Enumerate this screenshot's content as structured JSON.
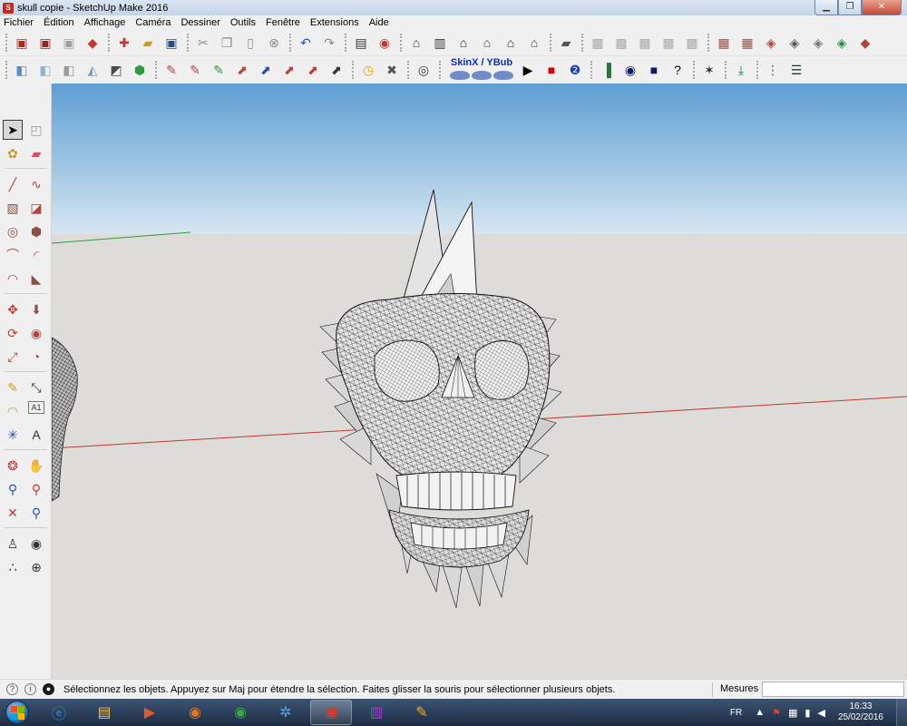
{
  "window": {
    "title": "skull copie - SketchUp Make 2016",
    "app_icon": "sketchup-logo-icon",
    "controls": [
      "minimize-icon",
      "maximize-icon",
      "close-icon"
    ]
  },
  "menu": [
    "Fichier",
    "Édition",
    "Affichage",
    "Caméra",
    "Dessiner",
    "Outils",
    "Fenêtre",
    "Extensions",
    "Aide"
  ],
  "toolbar1": [
    {
      "name": "open-model-icon",
      "glyph": "▣",
      "color": "#b8261b"
    },
    {
      "name": "model-info-icon",
      "glyph": "▣",
      "color": "#9d2420"
    },
    {
      "name": "component-icon",
      "glyph": "▣",
      "color": "#a0a0a0"
    },
    {
      "name": "ruby-icon",
      "glyph": "◆",
      "color": "#c0392b"
    },
    {
      "name": "new-file-icon",
      "glyph": "✚",
      "color": "#c0392b"
    },
    {
      "name": "open-folder-icon",
      "glyph": "▰",
      "color": "#c59a2f"
    },
    {
      "name": "save-icon",
      "glyph": "▣",
      "color": "#1f4e8c"
    },
    {
      "name": "cut-icon",
      "glyph": "✂",
      "color": "#8a8a8a"
    },
    {
      "name": "copy-icon",
      "glyph": "❐",
      "color": "#8a8a8a"
    },
    {
      "name": "paste-icon",
      "glyph": "▯",
      "color": "#8a8a8a"
    },
    {
      "name": "erase-selection-icon",
      "glyph": "⊗",
      "color": "#8a8a8a"
    },
    {
      "name": "undo-icon",
      "glyph": "↶",
      "color": "#1f55b8"
    },
    {
      "name": "redo-icon",
      "glyph": "↷",
      "color": "#8a8a8a"
    },
    {
      "name": "print-icon",
      "glyph": "▤",
      "color": "#333333"
    },
    {
      "name": "model-info-red-icon",
      "glyph": "◉",
      "color": "#c0392b"
    },
    {
      "name": "iso-view-icon",
      "glyph": "⌂",
      "color": "#333333"
    },
    {
      "name": "top-view-icon",
      "glyph": "▥",
      "color": "#333333"
    },
    {
      "name": "front-view-icon",
      "glyph": "⌂",
      "color": "#222222"
    },
    {
      "name": "right-view-icon",
      "glyph": "⌂",
      "color": "#444444"
    },
    {
      "name": "back-view-icon",
      "glyph": "⌂",
      "color": "#222222"
    },
    {
      "name": "left-view-icon",
      "glyph": "⌂",
      "color": "#444444"
    },
    {
      "name": "layers-icon",
      "glyph": "▰",
      "color": "#555555"
    },
    {
      "name": "style-xray-icon",
      "glyph": "▩",
      "color": "#aaaaaa"
    },
    {
      "name": "style-backedge-icon",
      "glyph": "▩",
      "color": "#aaaaaa"
    },
    {
      "name": "style-wireframe-icon",
      "glyph": "▩",
      "color": "#aaaaaa"
    },
    {
      "name": "style-hidden-icon",
      "glyph": "▩",
      "color": "#aaaaaa"
    },
    {
      "name": "style-shaded-icon",
      "glyph": "▩",
      "color": "#aaaaaa"
    },
    {
      "name": "sandbox-contours-icon",
      "glyph": "▦",
      "color": "#b0453a"
    },
    {
      "name": "sandbox-scratch-icon",
      "glyph": "▦",
      "color": "#b0453a"
    },
    {
      "name": "sandbox-smoove-icon",
      "glyph": "◈",
      "color": "#b0453a"
    },
    {
      "name": "sandbox-stamp-icon",
      "glyph": "◈",
      "color": "#555555"
    },
    {
      "name": "sandbox-drape-icon",
      "glyph": "◈",
      "color": "#777777"
    },
    {
      "name": "sandbox-detail-icon",
      "glyph": "◈",
      "color": "#2b8a3e"
    },
    {
      "name": "sandbox-flip-icon",
      "glyph": "◆",
      "color": "#b0453a"
    }
  ],
  "toolbar2": [
    {
      "name": "xray-cube-icon",
      "glyph": "◧",
      "color": "#5a8fc7"
    },
    {
      "name": "shaded-cube-icon",
      "glyph": "◧",
      "color": "#8fb0d8"
    },
    {
      "name": "monochrome-cube-icon",
      "glyph": "◧",
      "color": "#9a9a9a"
    },
    {
      "name": "textured-shape-icon",
      "glyph": "◭",
      "color": "#7aa0c8"
    },
    {
      "name": "section-plane-icon",
      "glyph": "◩",
      "color": "#4b4b4b"
    },
    {
      "name": "push-pull-green-icon",
      "glyph": "⬢",
      "color": "#2e9a3e"
    },
    {
      "name": "weld-icon",
      "glyph": "✎",
      "color": "#b0453a"
    },
    {
      "name": "curve-tool-icon",
      "glyph": "✎",
      "color": "#b0453a"
    },
    {
      "name": "bezier-icon",
      "glyph": "✎",
      "color": "#2e9a3e"
    },
    {
      "name": "extrude-icon",
      "glyph": "⬈",
      "color": "#b0453a"
    },
    {
      "name": "joint-push-icon",
      "glyph": "⬈",
      "color": "#2b4fb0"
    },
    {
      "name": "round-corner-icon",
      "glyph": "⬈",
      "color": "#b0453a"
    },
    {
      "name": "fredo-scale-icon",
      "glyph": "⬈",
      "color": "#b0453a"
    },
    {
      "name": "soften-icon",
      "glyph": "⬈",
      "color": "#333333"
    },
    {
      "name": "clock-icon",
      "glyph": "◷",
      "color": "#e0a800"
    },
    {
      "name": "tools-icon",
      "glyph": "✖",
      "color": "#555555"
    },
    {
      "name": "compass-icon",
      "glyph": "◎",
      "color": "#333333"
    }
  ],
  "skin_toolbar": {
    "label": "SkinX / YBub"
  },
  "toolbar2_tail": [
    {
      "name": "play-icon",
      "glyph": "▶",
      "color": "#000000"
    },
    {
      "name": "stop-icon",
      "glyph": "■",
      "color": "#d40000"
    },
    {
      "name": "number-two-icon",
      "glyph": "❷",
      "color": "#1d3fb3"
    },
    {
      "name": "green-bars-icon",
      "glyph": "▐",
      "color": "#1d7a3a"
    },
    {
      "name": "circle-icon",
      "glyph": "◉",
      "color": "#0b1a6e"
    },
    {
      "name": "blue-square-icon",
      "glyph": "■",
      "color": "#0b1a6e"
    },
    {
      "name": "help-icon",
      "glyph": "?",
      "color": "#000000"
    },
    {
      "name": "wireframe-cube-icon",
      "glyph": "✶",
      "color": "#333333"
    },
    {
      "name": "import-down-icon",
      "glyph": "⤓",
      "color": "#1d7a3a"
    },
    {
      "name": "grid-dots-icon",
      "glyph": "⋮",
      "color": "#1d7a3a"
    },
    {
      "name": "table-lines-icon",
      "glyph": "☰",
      "color": "#1d3a3a"
    }
  ],
  "left_tools": [
    [
      {
        "name": "select-tool-icon",
        "glyph": "➤",
        "color": "#000000",
        "active": true
      },
      {
        "name": "component-tool-icon",
        "glyph": "◰",
        "color": "#9a9a9a"
      }
    ],
    [
      {
        "name": "paint-bucket-icon",
        "glyph": "✿",
        "color": "#c59a2f"
      },
      {
        "name": "eraser-icon",
        "glyph": "▰",
        "color": "#d84f6e"
      }
    ],
    [
      {
        "name": "line-tool-icon",
        "glyph": "╱",
        "color": "#b0453a"
      },
      {
        "name": "freehand-tool-icon",
        "glyph": "∿",
        "color": "#b0453a"
      }
    ],
    [
      {
        "name": "rectangle-tool-icon",
        "glyph": "▧",
        "color": "#8a5040"
      },
      {
        "name": "rotated-rect-icon",
        "glyph": "◪",
        "color": "#b0453a"
      }
    ],
    [
      {
        "name": "circle-tool-icon",
        "glyph": "◎",
        "color": "#8a5040"
      },
      {
        "name": "polygon-tool-icon",
        "glyph": "⬢",
        "color": "#8a5040"
      }
    ],
    [
      {
        "name": "arc-tool-icon",
        "glyph": "⌒",
        "color": "#b0453a"
      },
      {
        "name": "two-point-arc-icon",
        "glyph": "◜",
        "color": "#b0453a"
      }
    ],
    [
      {
        "name": "three-point-arc-icon",
        "glyph": "◠",
        "color": "#b0453a"
      },
      {
        "name": "pie-tool-icon",
        "glyph": "◣",
        "color": "#8a5040"
      }
    ],
    [
      {
        "name": "move-tool-icon",
        "glyph": "✥",
        "color": "#c0392b"
      },
      {
        "name": "push-pull-icon",
        "glyph": "⬇",
        "color": "#8a5040"
      }
    ],
    [
      {
        "name": "rotate-tool-icon",
        "glyph": "⟳",
        "color": "#c0392b"
      },
      {
        "name": "follow-me-icon",
        "glyph": "◉",
        "color": "#b0453a"
      }
    ],
    [
      {
        "name": "scale-tool-icon",
        "glyph": "⤢",
        "color": "#c0392b"
      },
      {
        "name": "offset-tool-icon",
        "glyph": "◔",
        "color": "#c0392b"
      }
    ],
    [
      {
        "name": "tape-measure-icon",
        "glyph": "✎",
        "color": "#c59a2f"
      },
      {
        "name": "dimension-tool-icon",
        "glyph": "⤡",
        "color": "#333333"
      }
    ],
    [
      {
        "name": "protractor-icon",
        "glyph": "◠",
        "color": "#c59a2f"
      },
      {
        "name": "text-tool-icon",
        "glyph": "A1",
        "color": "#333333"
      }
    ],
    [
      {
        "name": "axes-tool-icon",
        "glyph": "✳",
        "color": "#2b4fb0"
      },
      {
        "name": "3d-text-icon",
        "glyph": "A",
        "color": "#333333"
      }
    ],
    [
      {
        "name": "orbit-tool-icon",
        "glyph": "❂",
        "color": "#c0392b"
      },
      {
        "name": "pan-tool-icon",
        "glyph": "✋",
        "color": "#c59a2f"
      }
    ],
    [
      {
        "name": "zoom-tool-icon",
        "glyph": "⚲",
        "color": "#2b4fb0"
      },
      {
        "name": "zoom-window-icon",
        "glyph": "⚲",
        "color": "#c0392b"
      }
    ],
    [
      {
        "name": "zoom-extents-icon",
        "glyph": "✕",
        "color": "#c0392b"
      },
      {
        "name": "zoom-extents-alt-icon",
        "glyph": "⚲",
        "color": "#2b4fb0"
      }
    ],
    [
      {
        "name": "position-camera-icon",
        "glyph": "♙",
        "color": "#333333"
      },
      {
        "name": "look-around-icon",
        "glyph": "◉",
        "color": "#333333"
      }
    ],
    [
      {
        "name": "walk-tool-icon",
        "glyph": "∴",
        "color": "#222222"
      },
      {
        "name": "section-tool-icon",
        "glyph": "⊕",
        "color": "#333333"
      }
    ]
  ],
  "status": {
    "icons": [
      "geo-location-icon",
      "credits-icon",
      "user-icon"
    ],
    "message": "Sélectionnez les objets. Appuyez sur Maj pour étendre la sélection. Faites glisser la souris pour sélectionner plusieurs objets.",
    "measurements_label": "Mesures",
    "measurements_value": ""
  },
  "taskbar": {
    "start": "windows-start-orb-icon",
    "apps": [
      {
        "name": "internet-explorer-icon",
        "glyph": "ⓔ",
        "color": "#2a8fe0",
        "active": false
      },
      {
        "name": "file-explorer-icon",
        "glyph": "▤",
        "color": "#e6c15a",
        "active": false
      },
      {
        "name": "media-player-icon",
        "glyph": "▶",
        "color": "#e05a2a",
        "active": false
      },
      {
        "name": "firefox-icon",
        "glyph": "◉",
        "color": "#e8741e",
        "active": false
      },
      {
        "name": "chrome-icon",
        "glyph": "◉",
        "color": "#3aa845",
        "active": false
      },
      {
        "name": "molecule-app-icon",
        "glyph": "✲",
        "color": "#5aa0e0",
        "active": false
      },
      {
        "name": "sketchup-task-icon",
        "glyph": "▣",
        "color": "#d63a2a",
        "active": true
      },
      {
        "name": "bars-app-icon",
        "glyph": "▥",
        "color": "#a03ad6",
        "active": false
      },
      {
        "name": "paint-palette-icon",
        "glyph": "✎",
        "color": "#e0b03a",
        "active": false
      }
    ],
    "language": "FR",
    "tray_icons": [
      "show-hidden-icon",
      "flag-icon",
      "network-icon",
      "signal-icon",
      "volume-muted-icon"
    ],
    "time": "16:33",
    "date": "25/02/2016"
  },
  "colors": {
    "sky_top": "#5e9fd3",
    "sky_bottom": "#d6e6f1",
    "ground": "#dddcd8",
    "red_axis": "#c0392b",
    "green_axis": "#2e9a3e"
  }
}
